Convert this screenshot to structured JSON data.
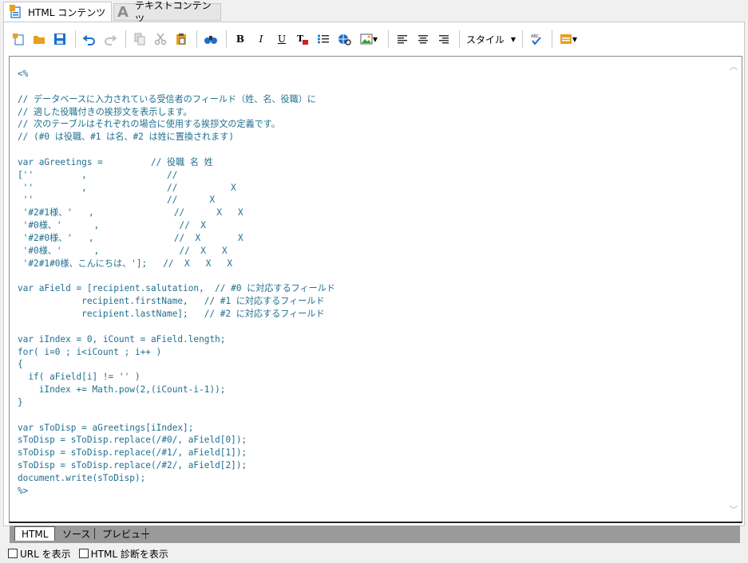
{
  "tabs": {
    "html_label": "HTML コンテンツ",
    "text_label": "テキストコンテンツ"
  },
  "toolbar": {
    "bold": "B",
    "italic": "I",
    "underline": "U",
    "style_label": "スタイル"
  },
  "editor": {
    "lines": [
      "<%",
      "",
      "// データベースに入力されている受信者のフィールド（姓、名、役職）に",
      "// 適した役職付きの挨拶文を表示します。",
      "// 次のテーブルはそれぞれの場合に使用する挨拶文の定義です。",
      "// (#0 は役職、#1 は名、#2 は姓に置換されます)",
      "",
      "var aGreetings =         // 役職 名 姓",
      "[''         ,               //",
      " ''         ,               //          X",
      " ''                         //      X",
      " '#2#1様、'   ,               //      X   X",
      " '#0様、'      ,               //  X",
      " '#2#0様、'   ,               //  X       X",
      " '#0様、'      ,               //  X   X",
      " '#2#1#0様、こんにちは、'];   //  X   X   X",
      "",
      "var aField = [recipient.salutation,  // #0 に対応するフィールド",
      "            recipient.firstName,   // #1 に対応するフィールド",
      "            recipient.lastName];   // #2 に対応するフィールド",
      "",
      "var iIndex = 0, iCount = aField.length;",
      "for( i=0 ; i<iCount ; i++ )",
      "{",
      "  if( aField[i] != '' )",
      "    iIndex += Math.pow(2,(iCount-i-1));",
      "}",
      "",
      "var sToDisp = aGreetings[iIndex];",
      "sToDisp = sToDisp.replace(/#0/, aField[0]);",
      "sToDisp = sToDisp.replace(/#1/, aField[1]);",
      "sToDisp = sToDisp.replace(/#2/, aField[2]);",
      "document.write(sToDisp);",
      "%>"
    ]
  },
  "view_tabs": {
    "html": "HTML",
    "source": "ソース",
    "preview": "プレビュー"
  },
  "footer": {
    "show_url": "URL を表示",
    "html_diagnosis": "HTML 診断を表示"
  },
  "colors": {
    "code_text": "#1f6f8f",
    "tab_strip": "#9a9a9a",
    "accent_blue": "#1e6fc9",
    "accent_orange": "#e8a020"
  }
}
